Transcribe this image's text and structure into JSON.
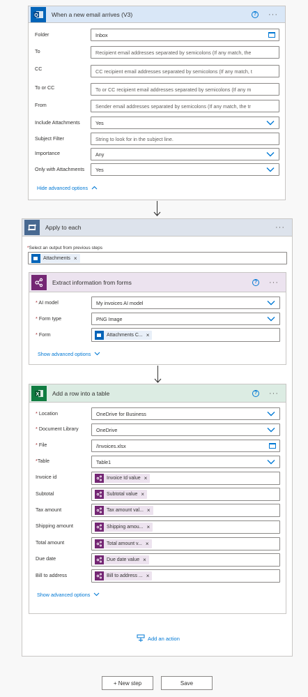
{
  "trigger": {
    "title": "When a new email arrives (V3)",
    "fields": [
      {
        "label": "Folder",
        "value": "Inbox"
      },
      {
        "label": "To",
        "placeholder": "Recipient email addresses separated by semicolons (If any match, the"
      },
      {
        "label": "CC",
        "placeholder": "CC recipient email addresses separated by semicolons (If any match, t"
      },
      {
        "label": "To or CC",
        "placeholder": "To or CC recipient email addresses separated by semicolons (If any m"
      },
      {
        "label": "From",
        "placeholder": "Sender email addresses separated by semicolons (If any match, the tr"
      },
      {
        "label": "Include Attachments",
        "value": "Yes"
      },
      {
        "label": "Subject Filter",
        "placeholder": "String to look for in the subject line."
      },
      {
        "label": "Importance",
        "value": "Any"
      },
      {
        "label": "Only with Attachments",
        "value": "Yes"
      }
    ],
    "advanced_label": "Hide advanced options"
  },
  "apply": {
    "title": "Apply to each",
    "select_label": "Select an output from previous steps",
    "chip": "Attachments"
  },
  "extract": {
    "title": "Extract information from forms",
    "fields": [
      {
        "label": "AI model",
        "value": "My invoices AI model"
      },
      {
        "label": "Form type",
        "value": "PNG Image"
      },
      {
        "label": "Form",
        "chip": "Attachments C..."
      }
    ],
    "advanced_label": "Show advanced options"
  },
  "addrow": {
    "title": "Add a row into a table",
    "fields": [
      {
        "label": "Location",
        "value": "OneDrive for Business"
      },
      {
        "label": "Document Library",
        "value": "OneDrive"
      },
      {
        "label": "File",
        "value": "/Invoices.xlsx"
      },
      {
        "label": "Table",
        "value": "Table1"
      },
      {
        "label": "Invoice id",
        "chip": "Invoice Id value"
      },
      {
        "label": "Subtotal",
        "chip": "Subtotal value"
      },
      {
        "label": "Tax amount",
        "chip": "Tax amount val..."
      },
      {
        "label": "Shipping amount",
        "chip": "Shipping amou..."
      },
      {
        "label": "Total amount",
        "chip": "Total amount v..."
      },
      {
        "label": "Due date",
        "chip": "Due date value"
      },
      {
        "label": "Bill to address",
        "chip": "Bill to address ..."
      }
    ],
    "advanced_label": "Show advanced options"
  },
  "add_action": "Add an action",
  "new_step": "+ New step",
  "save": "Save",
  "colors": {
    "outlook_header": "#d9e7f7",
    "loop_header": "#dde3ec",
    "ai_header": "#ece3ef",
    "excel_header": "#dcece3",
    "accent": "#0078d4"
  }
}
